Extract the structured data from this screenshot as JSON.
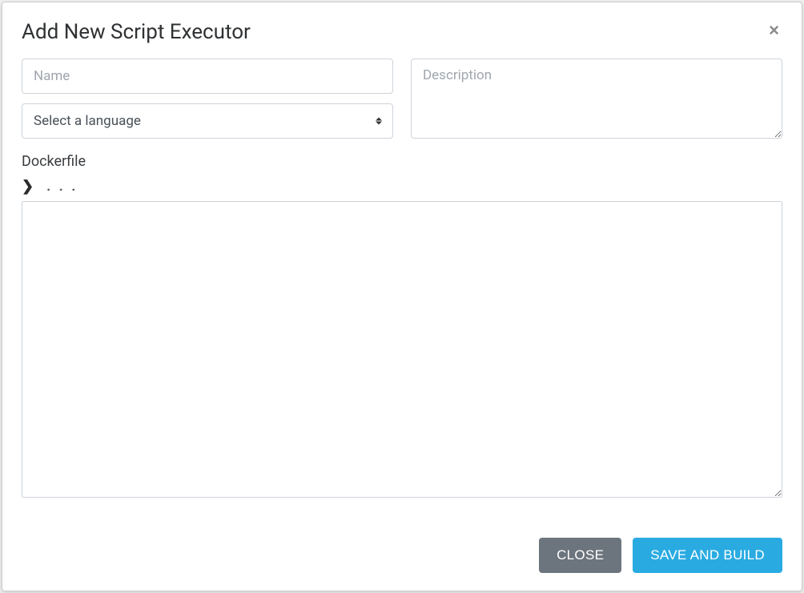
{
  "modal": {
    "title": "Add New Script Executor",
    "close_symbol": "×"
  },
  "fields": {
    "name_placeholder": "Name",
    "name_value": "",
    "language_placeholder": "Select a language",
    "description_placeholder": "Description",
    "description_value": "",
    "dockerfile_label": "Dockerfile",
    "code_collapse_marker": ". . .",
    "code_value": ""
  },
  "footer": {
    "close_label": "CLOSE",
    "save_label": "SAVE AND BUILD"
  }
}
